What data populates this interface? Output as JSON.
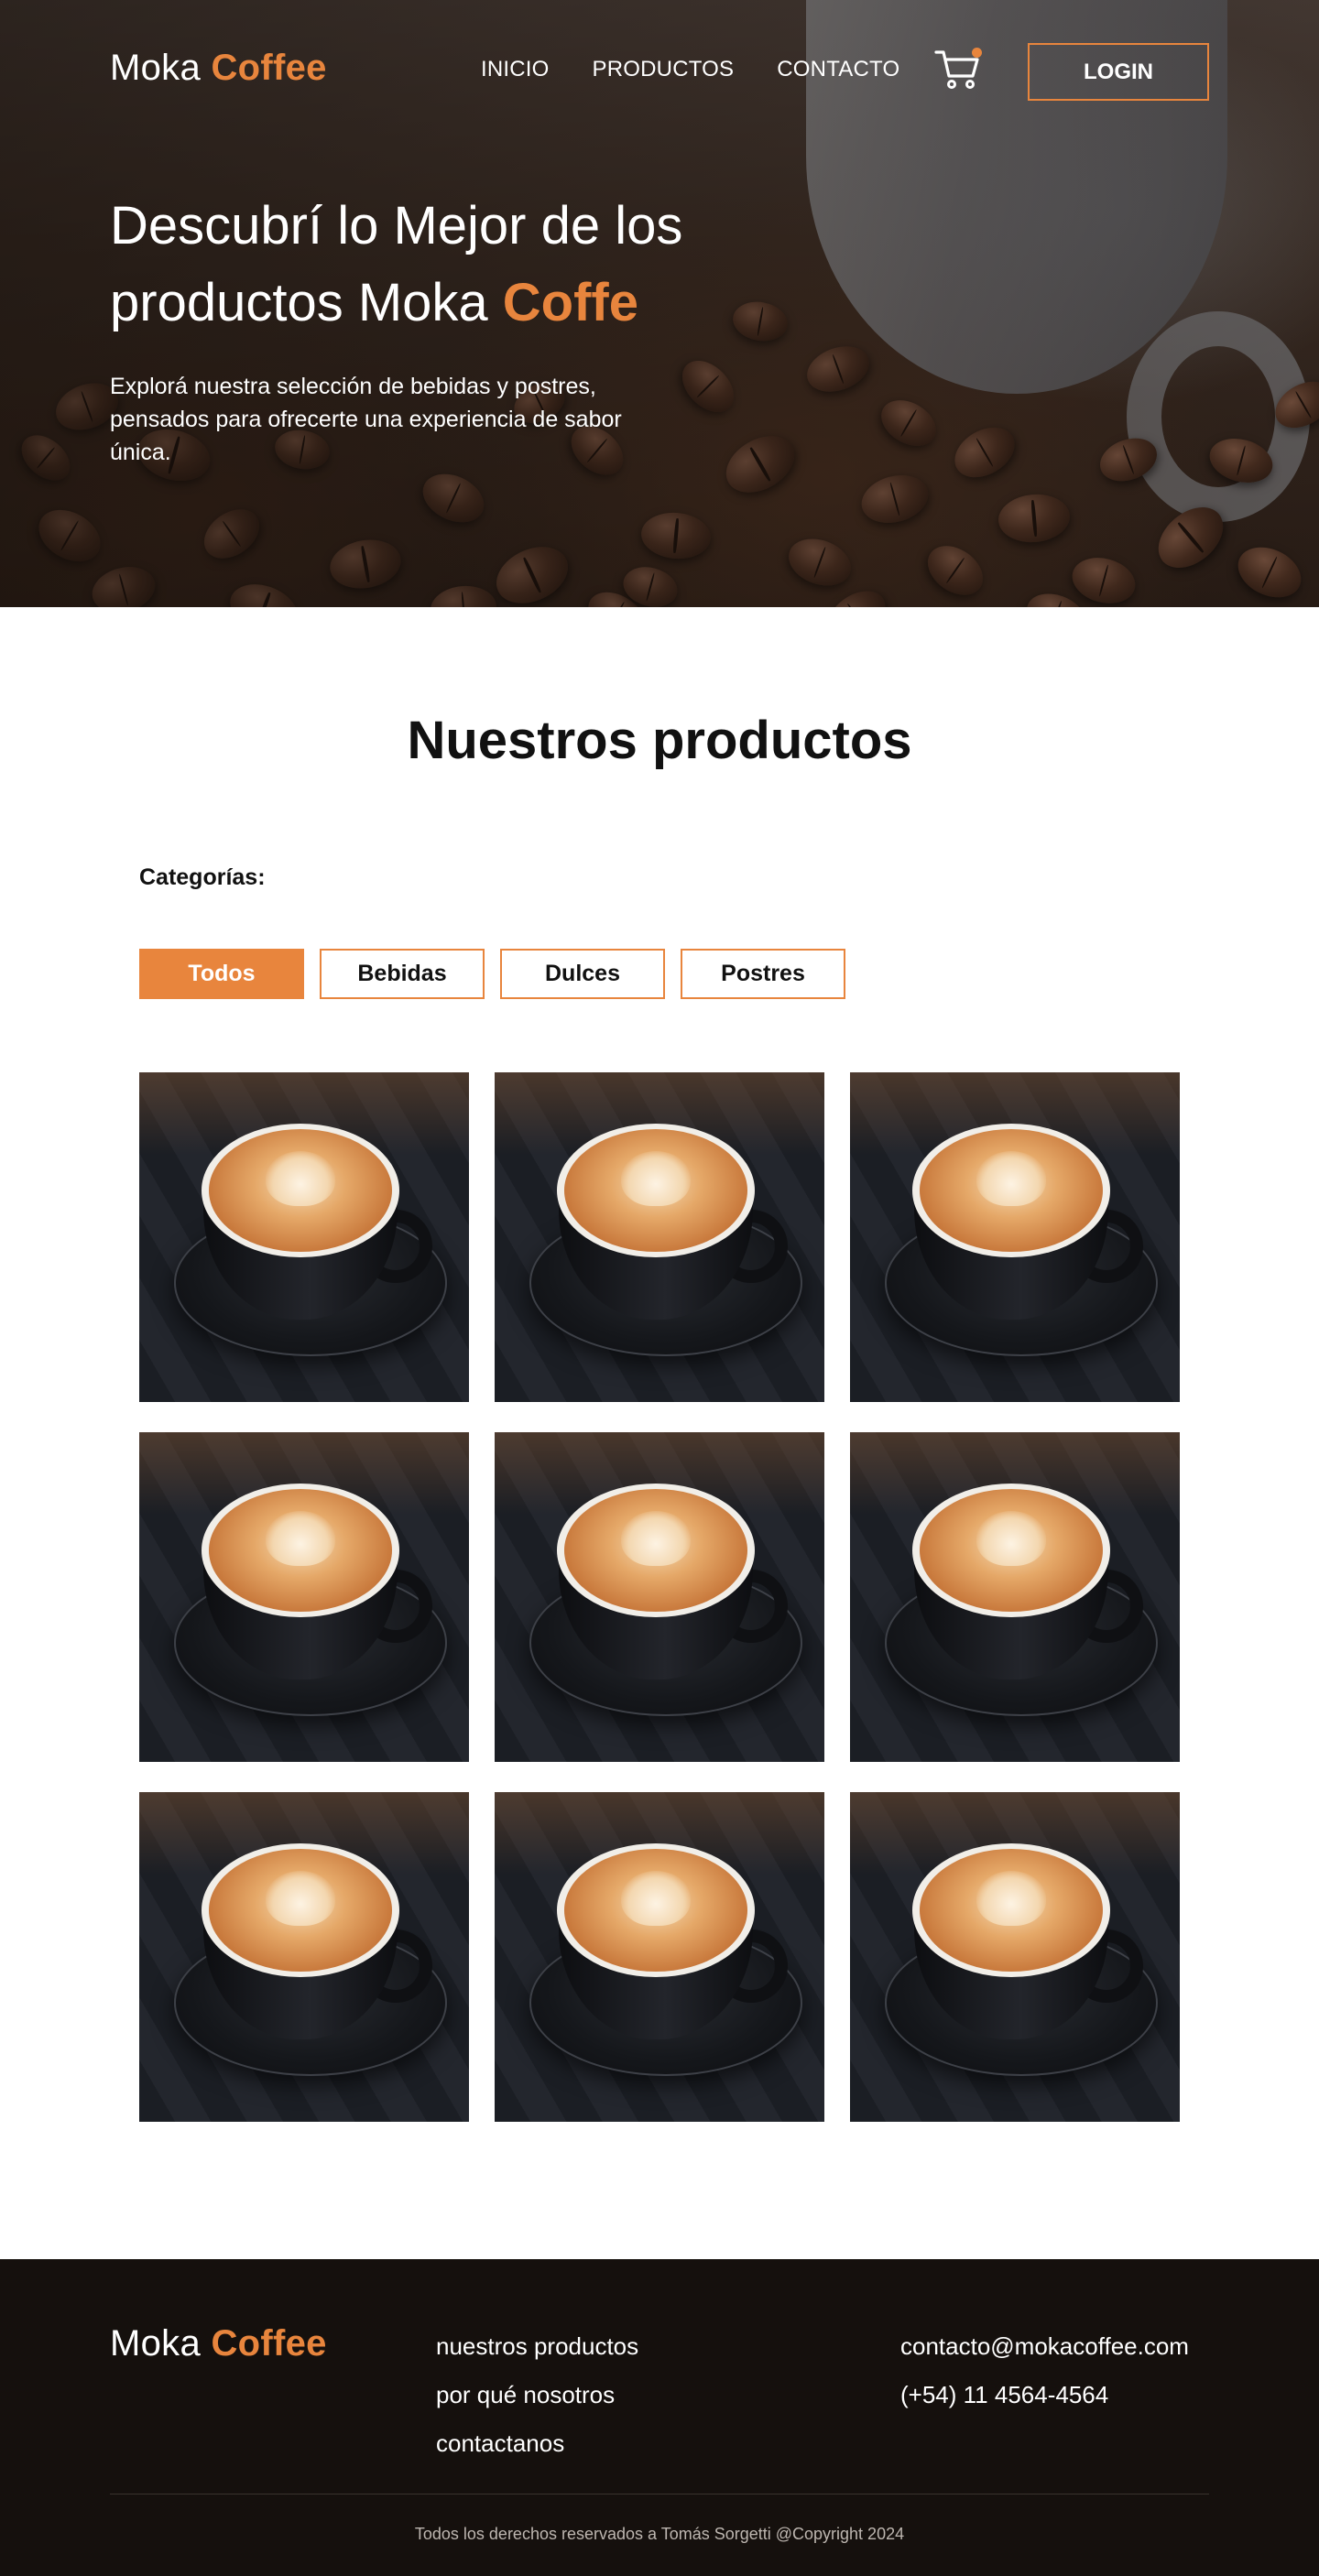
{
  "brand": {
    "name_part1": "Moka",
    "name_part2": "Coffee"
  },
  "colors": {
    "accent": "#e8853d",
    "footer_bg": "#15100d",
    "text_dark": "#111111"
  },
  "nav": {
    "items": [
      {
        "label": "INICIO"
      },
      {
        "label": "PRODUCTOS"
      },
      {
        "label": "CONTACTO"
      }
    ],
    "cart_icon": "shopping-cart-icon",
    "login_label": "LOGIN"
  },
  "hero": {
    "title_line1": "Descubrí lo Mejor de los",
    "title_line2_prefix": "productos Moka",
    "title_accent": "Coffe",
    "description": "Explorá nuestra selección de bebidas y postres, pensados para ofrecerte una experiencia de sabor única."
  },
  "products": {
    "section_title": "Nuestros productos",
    "categories_label": "Categorías:",
    "filters": [
      {
        "label": "Todos",
        "active": true
      },
      {
        "label": "Bebidas",
        "active": false
      },
      {
        "label": "Dulces",
        "active": false
      },
      {
        "label": "Postres",
        "active": false
      }
    ],
    "item_count": 9
  },
  "footer": {
    "links": [
      {
        "label": "nuestros productos"
      },
      {
        "label": "por qué nosotros"
      },
      {
        "label": "contactanos"
      }
    ],
    "email": "contacto@mokacoffee.com",
    "phone": "(+54) 11 4564-4564",
    "copyright": "Todos los derechos reservados a Tomás Sorgetti @Copyright 2024"
  }
}
